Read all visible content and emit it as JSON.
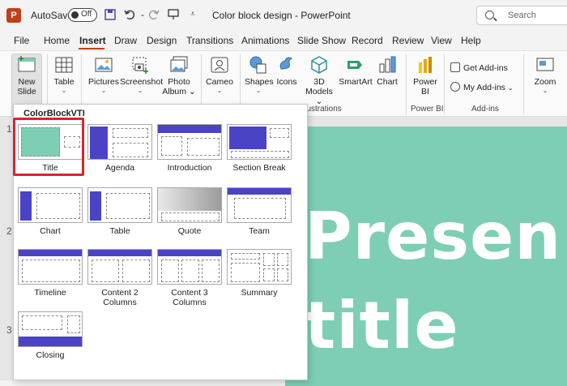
{
  "titlebar": {
    "app_logo_text": "P",
    "autosave_label": "AutoSave",
    "autosave_state": "Off",
    "doc_title": "Color block design  -  PowerPoint",
    "search_placeholder": "Search"
  },
  "menu": [
    "File",
    "Home",
    "Insert",
    "Draw",
    "Design",
    "Transitions",
    "Animations",
    "Slide Show",
    "Record",
    "Review",
    "View",
    "Help"
  ],
  "menu_active": "Insert",
  "ribbon": {
    "new_slide": [
      "New",
      "Slide"
    ],
    "table": "Table",
    "pictures": "Pictures",
    "screenshot": "Screenshot",
    "photo_album": [
      "Photo",
      "Album"
    ],
    "cameo": "Cameo",
    "shapes": "Shapes",
    "icons": "Icons",
    "models_3d": [
      "3D",
      "Models"
    ],
    "smartart": "SmartArt",
    "chart": "Chart",
    "power_bi": [
      "Power",
      "BI"
    ],
    "get_addins": "Get Add-ins",
    "my_addins": "My Add-ins",
    "zoom": "Zoom",
    "group_illustrations": "llustrations",
    "group_powerbi": "Power BI",
    "group_addins": "Add-ins"
  },
  "dropdown": {
    "header": "ColorBlockVTI",
    "layouts": [
      {
        "name": "Title",
        "lines": [
          "Title"
        ]
      },
      {
        "name": "Agenda",
        "lines": [
          "Agenda"
        ]
      },
      {
        "name": "Introduction",
        "lines": [
          "Introduction"
        ]
      },
      {
        "name": "Section Break",
        "lines": [
          "Section Break"
        ]
      },
      {
        "name": "Chart",
        "lines": [
          "Chart"
        ]
      },
      {
        "name": "Table",
        "lines": [
          "Table"
        ]
      },
      {
        "name": "Quote",
        "lines": [
          "Quote"
        ]
      },
      {
        "name": "Team",
        "lines": [
          "Team"
        ]
      },
      {
        "name": "Timeline",
        "lines": [
          "Timeline"
        ]
      },
      {
        "name": "Content 2 Columns",
        "lines": [
          "Content 2",
          "Columns"
        ]
      },
      {
        "name": "Content 3 Columns",
        "lines": [
          "Content 3",
          "Columns"
        ]
      },
      {
        "name": "Summary",
        "lines": [
          "Summary"
        ]
      },
      {
        "name": "Closing",
        "lines": [
          "Closing"
        ]
      }
    ],
    "selected": "Title"
  },
  "thumbnail_numbers": [
    "1",
    "2",
    "3"
  ],
  "slide": {
    "line1": "Presen",
    "line2": "title"
  },
  "colors": {
    "accent": "#c43e1c",
    "slide_bg": "#7dceb5",
    "layout_blue": "#4b43c6",
    "selection": "#d6262c"
  }
}
